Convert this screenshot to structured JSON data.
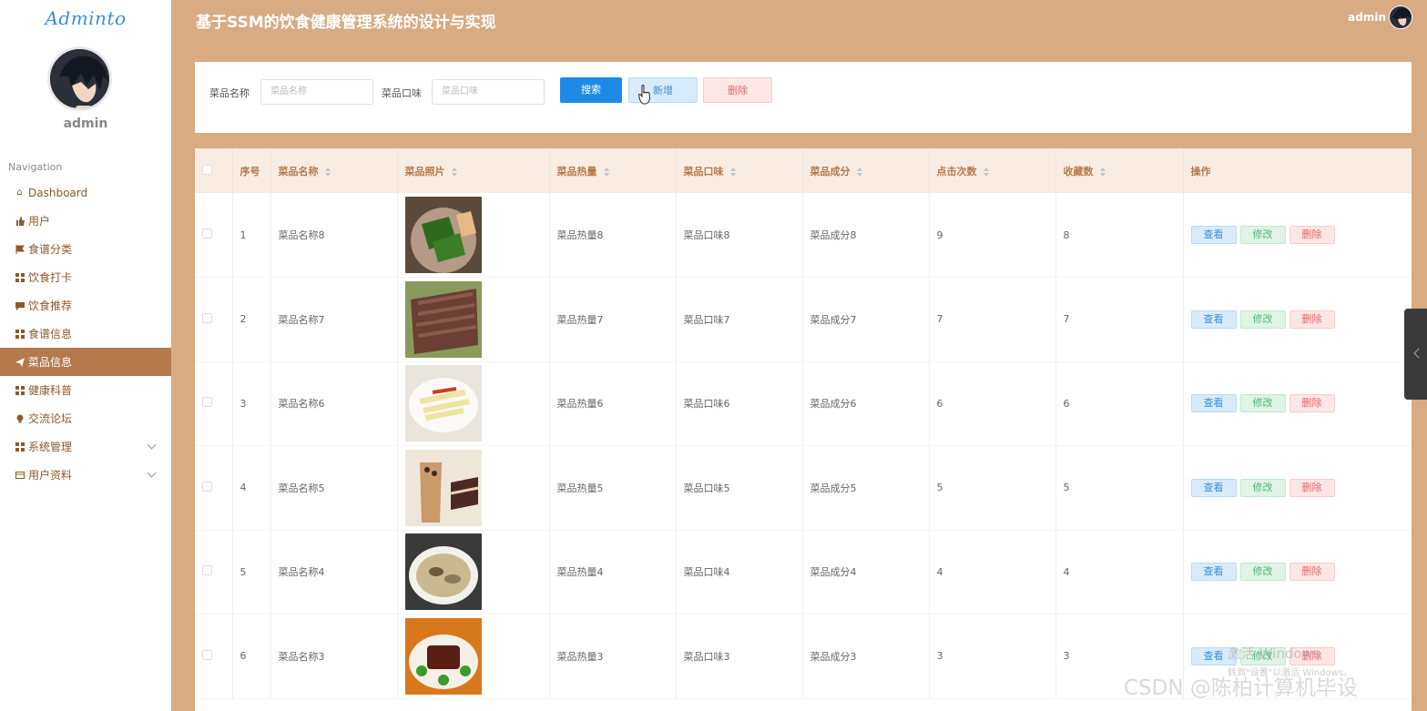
{
  "sidebar": {
    "logo": "Adminto",
    "username": "admin",
    "nav_heading": "Navigation",
    "items": [
      {
        "label": "Dashboard",
        "icon": "home-icon"
      },
      {
        "label": "用户",
        "icon": "thumbs-up-icon"
      },
      {
        "label": "食谱分类",
        "icon": "flag-icon"
      },
      {
        "label": "饮食打卡",
        "icon": "grid-icon"
      },
      {
        "label": "饮食推荐",
        "icon": "comment-icon"
      },
      {
        "label": "食谱信息",
        "icon": "grid-icon"
      },
      {
        "label": "菜品信息",
        "icon": "paper-plane-icon",
        "active": true
      },
      {
        "label": "健康科普",
        "icon": "grid-icon"
      },
      {
        "label": "交流论坛",
        "icon": "lightbulb-icon"
      },
      {
        "label": "系统管理",
        "icon": "grid-icon",
        "expandable": true
      },
      {
        "label": "用户资料",
        "icon": "id-card-icon",
        "expandable": true
      }
    ]
  },
  "header": {
    "title": "基于SSM的饮食健康管理系统的设计与实现",
    "user": "admin"
  },
  "search": {
    "name_label": "菜品名称",
    "name_placeholder": "菜品名称",
    "taste_label": "菜品口味",
    "taste_placeholder": "菜品口味",
    "search_button": "搜索",
    "add_button": "新增",
    "delete_button": "删除"
  },
  "table": {
    "columns": [
      "序号",
      "菜品名称",
      "菜品照片",
      "菜品热量",
      "菜品口味",
      "菜品成分",
      "点击次数",
      "收藏数",
      "操作"
    ],
    "rows": [
      {
        "index": "1",
        "name": "菜品名称8",
        "heat": "菜品热量8",
        "taste": "菜品口味8",
        "ingredient": "菜品成分8",
        "clicks": "9",
        "favorites": "8"
      },
      {
        "index": "2",
        "name": "菜品名称7",
        "heat": "菜品热量7",
        "taste": "菜品口味7",
        "ingredient": "菜品成分7",
        "clicks": "7",
        "favorites": "7"
      },
      {
        "index": "3",
        "name": "菜品名称6",
        "heat": "菜品热量6",
        "taste": "菜品口味6",
        "ingredient": "菜品成分6",
        "clicks": "6",
        "favorites": "6"
      },
      {
        "index": "4",
        "name": "菜品名称5",
        "heat": "菜品热量5",
        "taste": "菜品口味5",
        "ingredient": "菜品成分5",
        "clicks": "5",
        "favorites": "5"
      },
      {
        "index": "5",
        "name": "菜品名称4",
        "heat": "菜品热量4",
        "taste": "菜品口味4",
        "ingredient": "菜品成分4",
        "clicks": "4",
        "favorites": "4"
      },
      {
        "index": "6",
        "name": "菜品名称3",
        "heat": "菜品热量3",
        "taste": "菜品口味3",
        "ingredient": "菜品成分3",
        "clicks": "3",
        "favorites": "3"
      }
    ],
    "actions": {
      "view": "查看",
      "edit": "修改",
      "delete": "删除"
    }
  },
  "overlay": {
    "watermark_line1": "激活 Windows",
    "watermark_line2": "转到\"设置\"以激活 Windows。",
    "csdn": "CSDN @陈柏计算机毕设"
  },
  "colors": {
    "background": "#d8ab82",
    "active_nav": "#b5794b",
    "primary": "#1e8ae8"
  }
}
